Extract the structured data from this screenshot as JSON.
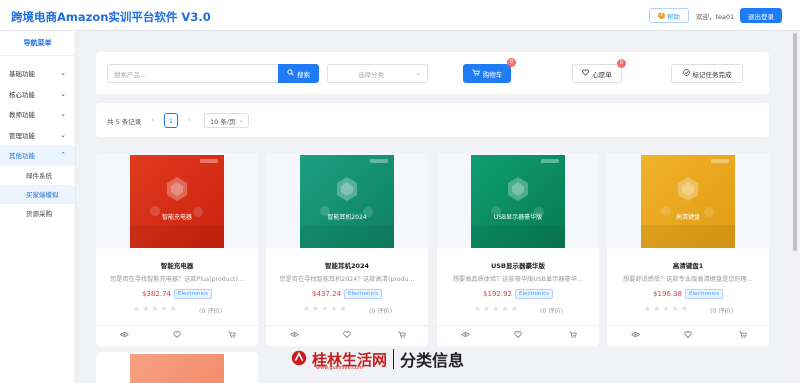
{
  "header": {
    "title": "跨境电商Amazon实训平台软件 V3.0",
    "help_label": "帮助",
    "welcome_text": "欢迎，tea01",
    "logout_label": "退出登录"
  },
  "sidebar": {
    "title": "导航菜单",
    "items": [
      {
        "label": "基础功能"
      },
      {
        "label": "核心功能"
      },
      {
        "label": "教师功能"
      },
      {
        "label": "管理功能"
      },
      {
        "label": "其他功能"
      }
    ],
    "sub_items": [
      {
        "label": "邮件系统"
      },
      {
        "label": "买家端模拟"
      },
      {
        "label": "货源采购"
      }
    ]
  },
  "toolbar": {
    "search_placeholder": "搜索产品...",
    "search_label": "搜索",
    "category_placeholder": "选择分类",
    "cart_label": "购物车",
    "cart_count": "0",
    "wishlist_label": "心愿单",
    "wishlist_count": "0",
    "task_label": "标记任务完成"
  },
  "pagination": {
    "total_text": "共 5 条记录",
    "current_page": "1",
    "page_size": "10 条/页"
  },
  "products": [
    {
      "name": "智能充电器",
      "image_text": "智能充电器",
      "desc": "您是否在寻找智能充电器？这款Plus(product)…",
      "price": "$382.74",
      "tag": "Electronics",
      "reviews": "(0 评价)",
      "color": "#e03a1e",
      "color2": "#c9230f"
    },
    {
      "name": "智能耳机2024",
      "image_text": "智能耳机2024",
      "desc": "您是否在寻找智能耳机2024？这款高清(produ…",
      "price": "$437.24",
      "tag": "Electronics",
      "reviews": "(0 评价)",
      "color": "#1aa080",
      "color2": "#0f7f63"
    },
    {
      "name": "USB显示器豪华版",
      "image_text": "USB显示器豪华版",
      "desc": "想要高品质体验？这款豪华版USB显示器豪华…",
      "price": "$192.92",
      "tag": "Electronics",
      "reviews": "(0 评价)",
      "color": "#0f9e6e",
      "color2": "#087a52"
    },
    {
      "name": "高清键盘1",
      "image_text": "高清键盘",
      "desc": "想要舒适感受？这款专业版高清键盘是您的理…",
      "price": "$196.38",
      "tag": "Electronics",
      "reviews": "(0 评价)",
      "color": "#f0b32a",
      "color2": "#e09b14"
    }
  ],
  "watermark": {
    "logo_text": "桂林生活网",
    "sub_text": "www.guilinlife.com",
    "right_text": "分类信息"
  }
}
